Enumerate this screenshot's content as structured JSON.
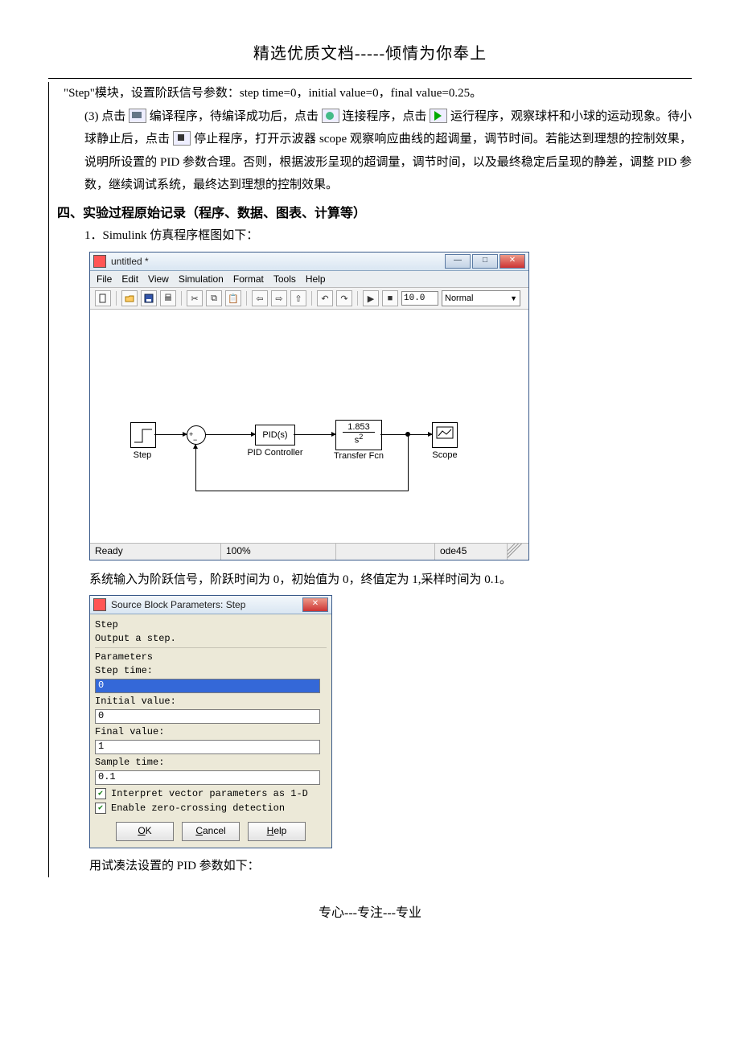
{
  "header": {
    "title": "精选优质文档-----倾情为你奉上"
  },
  "body": {
    "p1": "\"Step\"模块，设置阶跃信号参数：step time=0，initial value=0，final value=0.25。",
    "p2a": "(3) 点击",
    "p2b": "编译程序，待编译成功后，点击",
    "p2c": "连接程序，点击",
    "p2d": "运行程序，观察球杆和小球的运动现象。待小球静止后，点击",
    "p2e": "停止程序，打开示波器 scope 观察响应曲线的超调量，调节时间。若能达到理想的控制效果，说明所设置的 PID 参数合理。否则，根据波形呈现的超调量，调节时间，以及最终稳定后呈现的静差，调整 PID 参数，继续调试系统，最终达到理想的控制效果。",
    "section4": "四、实验过程原始记录（程序、数据、图表、计算等）",
    "item1": "1．Simulink 仿真程序框图如下：",
    "caption1": "系统输入为阶跃信号，阶跃时间为 0，初始值为 0，终值定为 1,采样时间为 0.1。",
    "caption2": "用试凑法设置的 PID 参数如下：",
    "footer": "专心---专注---专业"
  },
  "simwin": {
    "title": "untitled *",
    "menus": [
      "File",
      "Edit",
      "View",
      "Simulation",
      "Format",
      "Tools",
      "Help"
    ],
    "stop_time": "10.0",
    "mode": "Normal",
    "blocks": {
      "step": "Step",
      "pid_box": "PID(s)",
      "pid_label": "PID Controller",
      "tf_top": "1.853",
      "tf_bot": "s",
      "tf_exp": "2",
      "tf_label": "Transfer Fcn",
      "scope": "Scope"
    },
    "status": {
      "ready": "Ready",
      "zoom": "100%",
      "solver": "ode45"
    }
  },
  "stepdlg": {
    "title": "Source Block Parameters: Step",
    "heading": "Step",
    "desc": "Output a step.",
    "params_head": "Parameters",
    "step_time_label": "Step time:",
    "step_time_value": "0",
    "initial_label": "Initial value:",
    "initial_value": "0",
    "final_label": "Final value:",
    "final_value": "1",
    "sample_label": "Sample time:",
    "sample_value": "0.1",
    "chk1": "Interpret vector parameters as 1-D",
    "chk2": "Enable zero-crossing detection",
    "ok": "OK",
    "cancel": "Cancel",
    "help": "Help"
  }
}
